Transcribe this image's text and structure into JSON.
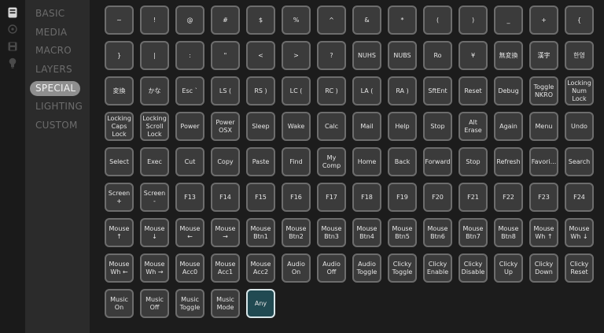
{
  "sidebar": {
    "items": [
      {
        "id": "basic",
        "label": "BASIC"
      },
      {
        "id": "media",
        "label": "MEDIA"
      },
      {
        "id": "macro",
        "label": "MACRO"
      },
      {
        "id": "layers",
        "label": "LAYERS"
      },
      {
        "id": "special",
        "label": "SPECIAL"
      },
      {
        "id": "lighting",
        "label": "LIGHTING"
      },
      {
        "id": "custom",
        "label": "CUSTOM"
      }
    ],
    "active": "special"
  },
  "iconbar": {
    "icons": [
      "keyboard-icon",
      "configure-icon",
      "save-icon",
      "lightbulb-icon"
    ]
  },
  "keys": [
    "~",
    "!",
    "@",
    "#",
    "$",
    "%",
    "^",
    "&",
    "*",
    "(",
    ")",
    "_",
    "+",
    "{",
    "}",
    "|",
    ":",
    "\"",
    "<",
    ">",
    "?",
    "NUHS",
    "NUBS",
    "Ro",
    "¥",
    "無変換",
    "漢字",
    "한영",
    "変換",
    "かな",
    "Esc `",
    "LS (",
    "RS )",
    "LC (",
    "RC )",
    "LA (",
    "RA )",
    "SftEnt",
    "Reset",
    "Debug",
    "Toggle\nNKRO",
    "Locking\nNum\nLock",
    "Locking\nCaps\nLock",
    "Locking\nScroll\nLock",
    "Power",
    "Power\nOSX",
    "Sleep",
    "Wake",
    "Calc",
    "Mail",
    "Help",
    "Stop",
    "Alt\nErase",
    "Again",
    "Menu",
    "Undo",
    "Select",
    "Exec",
    "Cut",
    "Copy",
    "Paste",
    "Find",
    "My\nComp",
    "Home",
    "Back",
    "Forward",
    "Stop",
    "Refresh",
    "Favori...",
    "Search",
    "Screen\n+",
    "Screen\n-",
    "F13",
    "F14",
    "F15",
    "F16",
    "F17",
    "F18",
    "F19",
    "F20",
    "F21",
    "F22",
    "F23",
    "F24",
    "Mouse\n↑",
    "Mouse\n↓",
    "Mouse\n←",
    "Mouse\n→",
    "Mouse\nBtn1",
    "Mouse\nBtn2",
    "Mouse\nBtn3",
    "Mouse\nBtn4",
    "Mouse\nBtn5",
    "Mouse\nBtn6",
    "Mouse\nBtn7",
    "Mouse\nBtn8",
    "Mouse\nWh ↑",
    "Mouse\nWh ↓",
    "Mouse\nWh ←",
    "Mouse\nWh →",
    "Mouse\nAcc0",
    "Mouse\nAcc1",
    "Mouse\nAcc2",
    "Audio\nOn",
    "Audio\nOff",
    "Audio\nToggle",
    "Clicky\nToggle",
    "Clicky\nEnable",
    "Clicky\nDisable",
    "Clicky\nUp",
    "Clicky\nDown",
    "Clicky\nReset",
    "Music\nOn",
    "Music\nOff",
    "Music\nToggle",
    "Music\nMode",
    "Any"
  ],
  "selected_key": "Any",
  "colors": {
    "key_background": "#3b3b3b",
    "key_border": "#6d6d6d",
    "selected_background": "#214a52",
    "active_nav": "#8f8f8f"
  }
}
